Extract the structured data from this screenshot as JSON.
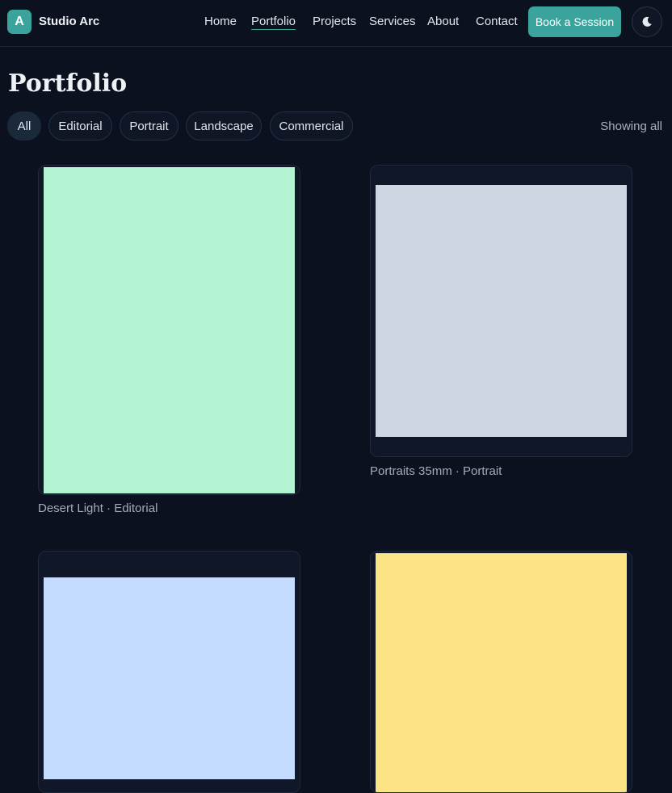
{
  "header": {
    "logo_letter": "A",
    "brand": "Studio Arc",
    "nav": [
      {
        "label": "Home",
        "active": false
      },
      {
        "label": "Portfolio",
        "active": true
      },
      {
        "label": "Projects",
        "active": false
      },
      {
        "label": "Services",
        "active": false
      },
      {
        "label": "About",
        "active": false
      },
      {
        "label": "Contact",
        "active": false
      }
    ],
    "cta_label": "Book a Session",
    "theme_toggle_icon": "moon-icon"
  },
  "page": {
    "title": "Portfolio",
    "filters": [
      {
        "label": "All",
        "selected": true
      },
      {
        "label": "Editorial",
        "selected": false
      },
      {
        "label": "Portrait",
        "selected": false
      },
      {
        "label": "Landscape",
        "selected": false
      },
      {
        "label": "Commercial",
        "selected": false
      }
    ],
    "status": "Showing all"
  },
  "gallery": {
    "items": [
      {
        "caption": "Desert Light · Editorial",
        "color": "#b3f3d1"
      },
      {
        "caption": "Portraits 35mm · Portrait",
        "color": "#cdd6e2"
      },
      {
        "caption": "",
        "color": "#c3dcff"
      },
      {
        "caption": "",
        "color": "#fbe386"
      }
    ]
  },
  "colors": {
    "accent": "#3aa39b",
    "background": "#0c1120"
  }
}
